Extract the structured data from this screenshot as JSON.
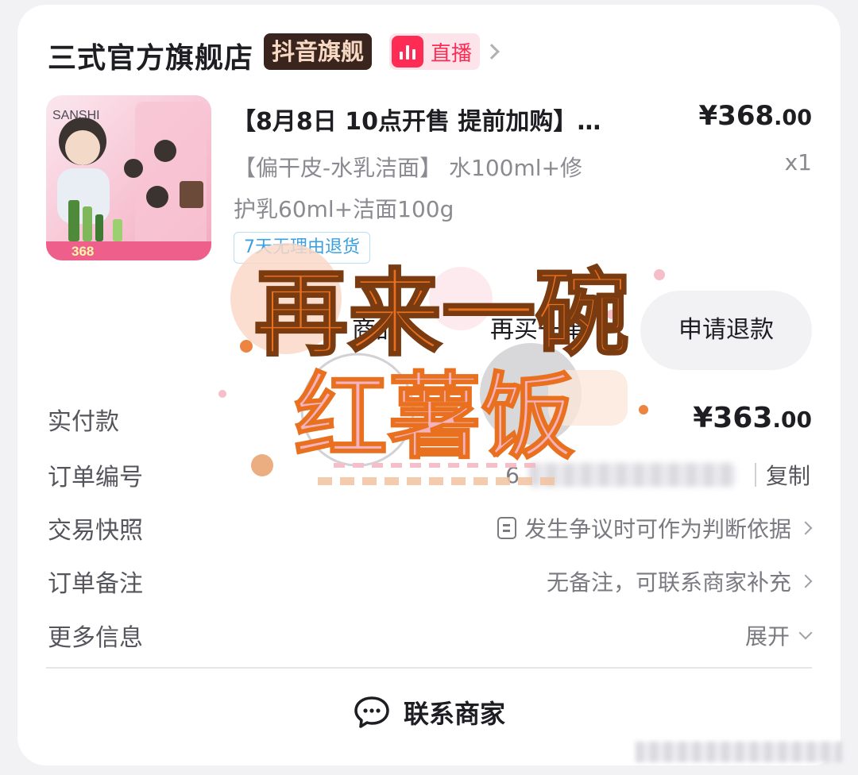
{
  "header": {
    "shop_name": "三式官方旗舰店",
    "badge": "抖音旗舰",
    "live_label": "直播"
  },
  "product": {
    "title": "【8月8日 10点开售 提前加购】…",
    "price_main": "¥368",
    "price_cents": ".00",
    "spec_line1": "【偏干皮-水乳洁面】 水100ml+修",
    "spec_line2": "护乳60ml+洁面100g",
    "quantity": "x1",
    "tag": "7天无理由退货",
    "thumb_brand": "SANSHI",
    "thumb_price": "368"
  },
  "actions": {
    "refund": "申请退款",
    "btn_left": "商品",
    "btn_mid": "再买一单"
  },
  "sticker": {
    "line1": "再来一碗",
    "line2": "红薯饭"
  },
  "info": {
    "paid_label": "实付款",
    "paid_main": "¥363",
    "paid_cents": ".00",
    "order_no_label": "订单编号",
    "order_no_prefix": "6",
    "copy": "复制",
    "snapshot_label": "交易快照",
    "snapshot_value": "发生争议时可作为判断依据",
    "remark_label": "订单备注",
    "remark_value": "无备注，可联系商家补充",
    "more_label": "更多信息",
    "more_value": "展开"
  },
  "footer": {
    "contact": "联系商家"
  },
  "colors": {
    "accent": "#fe2c55",
    "badge_bg": "#3a241e",
    "sticker_orange": "#e8701f",
    "sticker_pink": "#f5b3bf"
  }
}
